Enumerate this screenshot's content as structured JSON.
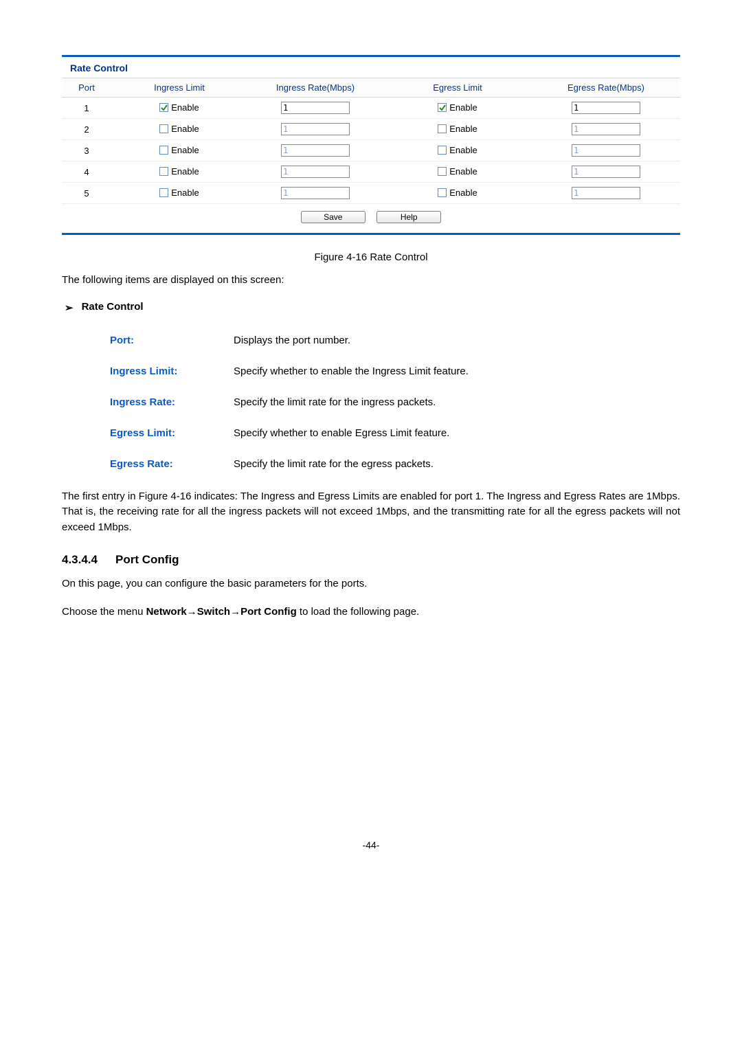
{
  "panel": {
    "title": "Rate Control",
    "columns": {
      "port": "Port",
      "ingress_limit": "Ingress Limit",
      "ingress_rate": "Ingress Rate(Mbps)",
      "egress_limit": "Egress Limit",
      "egress_rate": "Egress Rate(Mbps)"
    },
    "enable_label": "Enable",
    "rows": [
      {
        "port": "1",
        "ingress_enabled": true,
        "ingress_rate": "1",
        "egress_enabled": true,
        "egress_rate": "1"
      },
      {
        "port": "2",
        "ingress_enabled": false,
        "ingress_rate": "1",
        "egress_enabled": false,
        "egress_rate": "1"
      },
      {
        "port": "3",
        "ingress_enabled": false,
        "ingress_rate": "1",
        "egress_enabled": false,
        "egress_rate": "1"
      },
      {
        "port": "4",
        "ingress_enabled": false,
        "ingress_rate": "1",
        "egress_enabled": false,
        "egress_rate": "1"
      },
      {
        "port": "5",
        "ingress_enabled": false,
        "ingress_rate": "1",
        "egress_enabled": false,
        "egress_rate": "1"
      }
    ],
    "buttons": {
      "save": "Save",
      "help": "Help"
    }
  },
  "figure_caption": "Figure 4-16 Rate Control",
  "intro_line": "The following items are displayed on this screen:",
  "section_bullet": "Rate Control",
  "definitions": [
    {
      "term": "Port:",
      "desc": "Displays the port number."
    },
    {
      "term": "Ingress Limit:",
      "desc": "Specify whether to enable the Ingress Limit feature."
    },
    {
      "term": "Ingress Rate:",
      "desc": "Specify the limit rate for the ingress packets."
    },
    {
      "term": "Egress Limit:",
      "desc": "Specify whether to enable Egress Limit feature."
    },
    {
      "term": "Egress Rate:",
      "desc": "Specify the limit rate for the egress packets."
    }
  ],
  "paragraph": "The first entry in Figure 4-16 indicates: The Ingress and Egress Limits are enabled for port 1. The Ingress and Egress Rates are 1Mbps. That is, the receiving rate for all the ingress packets will not exceed 1Mbps, and the transmitting rate for all the egress packets will not exceed 1Mbps.",
  "heading": {
    "num": "4.3.4.4",
    "title": "Port Config"
  },
  "after_heading_line": "On this page, you can configure the basic parameters for the ports.",
  "menu_line": {
    "prefix": "Choose the menu ",
    "path": "Network→Switch→Port Config",
    "suffix": " to load the following page."
  },
  "page_number": "-44-"
}
